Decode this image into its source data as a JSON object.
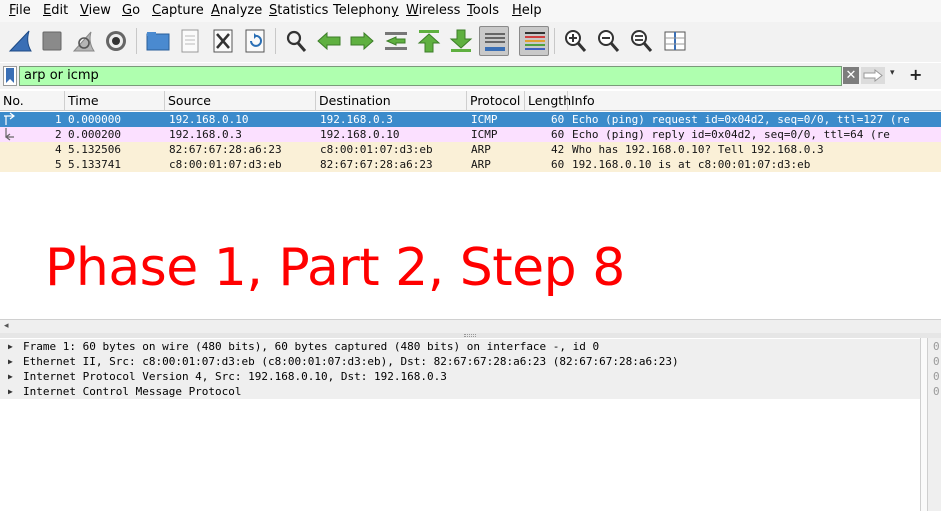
{
  "menu": [
    {
      "pre": "",
      "ul": "F",
      "post": "ile"
    },
    {
      "pre": "",
      "ul": "E",
      "post": "dit"
    },
    {
      "pre": "",
      "ul": "V",
      "post": "iew"
    },
    {
      "pre": "",
      "ul": "G",
      "post": "o"
    },
    {
      "pre": "",
      "ul": "C",
      "post": "apture"
    },
    {
      "pre": "",
      "ul": "A",
      "post": "nalyze"
    },
    {
      "pre": "",
      "ul": "S",
      "post": "tatistics"
    },
    {
      "pre": "Telephon",
      "ul": "y",
      "post": ""
    },
    {
      "pre": "",
      "ul": "W",
      "post": "ireless"
    },
    {
      "pre": "",
      "ul": "T",
      "post": "ools"
    },
    {
      "pre": "",
      "ul": "H",
      "post": "elp"
    }
  ],
  "toolbar": {
    "icons": [
      "shark-fin-start-icon",
      "stop-square-icon",
      "restart-shark-icon",
      "capture-options-gear-icon",
      "open-folder-icon",
      "save-file-icon",
      "close-file-icon",
      "reload-file-icon",
      "find-packet-icon",
      "go-back-icon",
      "go-forward-icon",
      "go-to-packet-icon",
      "go-first-icon",
      "go-last-icon",
      "auto-scroll-icon",
      "colorize-icon",
      "zoom-in-icon",
      "zoom-out-icon",
      "zoom-normal-icon",
      "resize-columns-icon"
    ]
  },
  "filter": {
    "value": "arp or icmp",
    "bg_color": "#afffaf",
    "clear_glyph": "✕",
    "add_glyph": "+",
    "dropdown_glyph": "▾"
  },
  "packet_list": {
    "columns": [
      "No.",
      "Time",
      "Source",
      "Destination",
      "Protocol",
      "Length",
      "Info"
    ],
    "rows": [
      {
        "no": "1",
        "time": "0.000000",
        "src": "192.168.0.10",
        "dst": "192.168.0.3",
        "proto": "ICMP",
        "len": "60",
        "info": "Echo (ping) request  id=0x04d2, seq=0/0, ttl=127 (re"
      },
      {
        "no": "2",
        "time": "0.000200",
        "src": "192.168.0.3",
        "dst": "192.168.0.10",
        "proto": "ICMP",
        "len": "60",
        "info": "Echo (ping) reply    id=0x04d2, seq=0/0, ttl=64 (re"
      },
      {
        "no": "4",
        "time": "5.132506",
        "src": "82:67:67:28:a6:23",
        "dst": "c8:00:01:07:d3:eb",
        "proto": "ARP",
        "len": "42",
        "info": "Who has 192.168.0.10? Tell 192.168.0.3"
      },
      {
        "no": "5",
        "time": "5.133741",
        "src": "c8:00:01:07:d3:eb",
        "dst": "82:67:67:28:a6:23",
        "proto": "ARP",
        "len": "60",
        "info": "192.168.0.10 is at c8:00:01:07:d3:eb"
      }
    ],
    "selected_color": "#3b8bcb",
    "icmp_color": "#fbe0ff",
    "arp_color": "#faf0d7"
  },
  "overlay_text": "Phase 1, Part 2, Step 8",
  "overlay_color": "#ff0000",
  "details": [
    "Frame 1: 60 bytes on wire (480 bits), 60 bytes captured (480 bits) on interface -, id 0",
    "Ethernet II, Src: c8:00:01:07:d3:eb (c8:00:01:07:d3:eb), Dst: 82:67:67:28:a6:23 (82:67:67:28:a6:23)",
    "Internet Protocol Version 4, Src: 192.168.0.10, Dst: 192.168.0.3",
    "Internet Control Message Protocol"
  ],
  "bytes_offsets": [
    "0",
    "0",
    "0",
    "0"
  ]
}
